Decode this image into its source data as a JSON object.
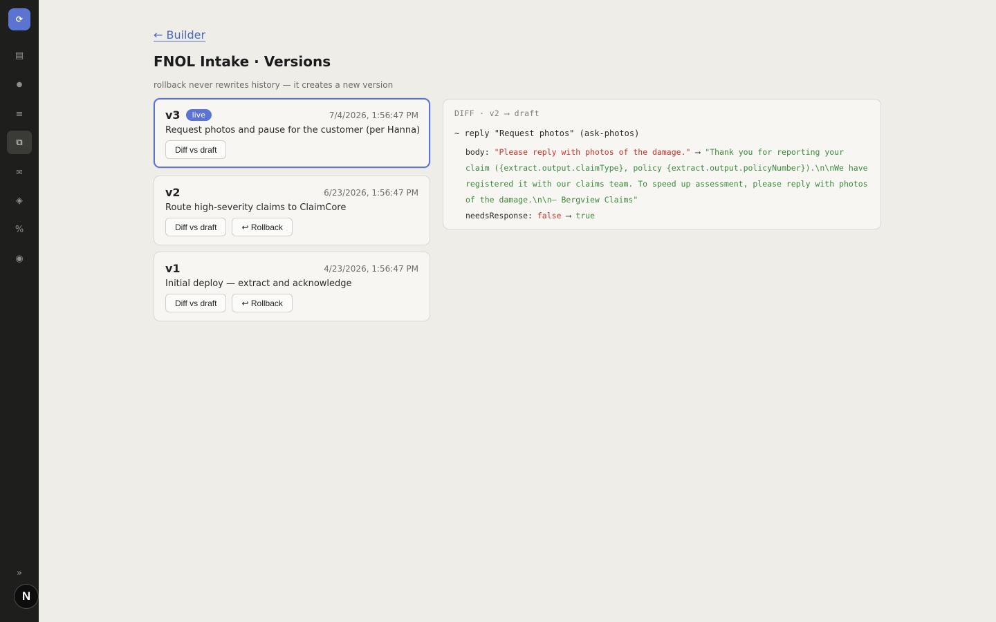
{
  "sidebar": {
    "logo_glyph": "⟳",
    "items": [
      {
        "name": "list-icon",
        "glyph": "▤"
      },
      {
        "name": "circle-icon",
        "glyph": "●"
      },
      {
        "name": "menu-icon",
        "glyph": "≡"
      },
      {
        "name": "versions-icon",
        "glyph": "⧉",
        "active": true
      },
      {
        "name": "mail-icon",
        "glyph": "✉"
      },
      {
        "name": "diamond-icon",
        "glyph": "◈"
      },
      {
        "name": "percent-icon",
        "glyph": "%"
      },
      {
        "name": "record-icon",
        "glyph": "◉"
      }
    ],
    "expand_glyph": "»",
    "avatar_initial": "N"
  },
  "header": {
    "back_link": "← Builder",
    "title": "FNOL Intake · Versions",
    "subtitle": "rollback never rewrites history — it creates a new version"
  },
  "versions": [
    {
      "label": "v3",
      "badge": "live",
      "date": "7/4/2026, 1:56:47 PM",
      "description": "Request photos and pause for the customer (per Hanna)",
      "diff_label": "Diff vs draft"
    },
    {
      "label": "v2",
      "date": "6/23/2026, 1:56:47 PM",
      "description": "Route high-severity claims to ClaimCore",
      "diff_label": "Diff vs draft",
      "rollback_label": "↩ Rollback"
    },
    {
      "label": "v1",
      "date": "4/23/2026, 1:56:47 PM",
      "description": "Initial deploy — extract and acknowledge",
      "diff_label": "Diff vs draft",
      "rollback_label": "↩ Rollback"
    }
  ],
  "diff": {
    "header": "DIFF · v2 ⟶ draft",
    "change_line": "~ reply \"Request photos\" (ask-photos)",
    "body_key": "body:",
    "body_old": "\"Please reply with photos of the damage.\"",
    "arrow": "⟶",
    "body_new": "\"Thank you for reporting your claim ({extract.output.claimType}, policy {extract.output.policyNumber}).\\n\\nWe have registered it with our claims team. To speed up assessment, please reply with photos of the damage.\\n\\n— Bergview Claims\"",
    "needs_key": "needsResponse:",
    "needs_old": "false",
    "needs_new": "true"
  },
  "colors": {
    "accent": "#5b73d1",
    "sidebar_bg": "#1e1e1c",
    "page_bg": "#eeede8",
    "diff_removed": "#c9332b",
    "diff_added": "#3a8a3a"
  }
}
